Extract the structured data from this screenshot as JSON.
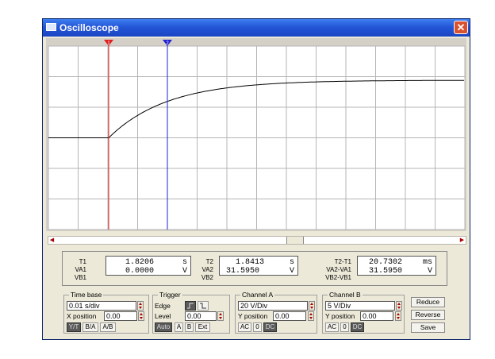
{
  "window": {
    "title": "Oscilloscope",
    "close_glyph": "✕"
  },
  "cursors": {
    "t1_label": "1",
    "t2_label": "2"
  },
  "readouts": {
    "t1": {
      "labels": [
        "T1",
        "VA1",
        "VB1"
      ],
      "time": "1.8206",
      "time_unit": "s",
      "va": "0.0000",
      "va_unit": "V"
    },
    "t2": {
      "labels": [
        "T2",
        "VA2",
        "VB2"
      ],
      "time": "1.8413",
      "time_unit": "s",
      "va": "31.5950",
      "va_unit": "V"
    },
    "diff": {
      "labels": [
        "T2-T1",
        "VA2-VA1",
        "VB2-VB1"
      ],
      "time": "20.7302",
      "time_unit": "ms",
      "va": "31.5950",
      "va_unit": "V"
    }
  },
  "timebase": {
    "title": "Time base",
    "scale": "0.01 s/div",
    "xpos_label": "X position",
    "xpos": "0.00",
    "modes": [
      "Y/T",
      "B/A",
      "A/B"
    ]
  },
  "trigger": {
    "title": "Trigger",
    "edge_label": "Edge",
    "level_label": "Level",
    "level": "0.00",
    "modes": [
      "Auto",
      "A",
      "B",
      "Ext"
    ]
  },
  "channel_a": {
    "title": "Channel A",
    "scale": "20 V/Div",
    "ypos_label": "Y position",
    "ypos": "0.00",
    "coupling": [
      "AC",
      "0",
      "DC"
    ]
  },
  "channel_b": {
    "title": "Channel B",
    "scale": "5 V/Div",
    "ypos_label": "Y position",
    "ypos": "0.00",
    "coupling": [
      "AC",
      "0",
      "DC"
    ]
  },
  "side_buttons": [
    "Reduce",
    "Reverse",
    "Save"
  ],
  "colors": {
    "title_bar": "#2456d6",
    "grid": "#b5b5b5",
    "trace": "#000000",
    "cursor1": "#e02020",
    "cursor2": "#2020d0"
  }
}
